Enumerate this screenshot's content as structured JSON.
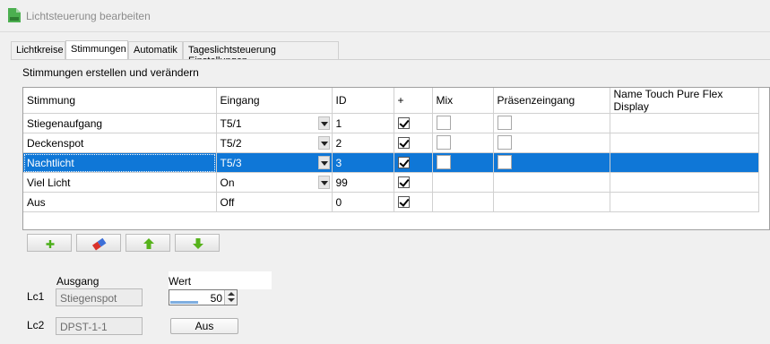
{
  "window": {
    "title": "Lichtsteuerung bearbeiten"
  },
  "tabs": [
    {
      "label": "Lichtkreise",
      "active": false
    },
    {
      "label": "Stimmungen",
      "active": true
    },
    {
      "label": "Automatik",
      "active": false
    },
    {
      "label": "Tageslichtsteuerung Einstellungen",
      "active": false
    }
  ],
  "panel": {
    "heading": "Stimmungen erstellen und verändern"
  },
  "grid": {
    "columns": [
      "Stimmung",
      "Eingang",
      "ID",
      "+",
      "Mix",
      "Präsenzeingang",
      "Name Touch Pure Flex Display"
    ],
    "rows": [
      {
        "stimmung": "Stiegenaufgang",
        "eingang": "T5/1",
        "id": "1",
        "plus": true,
        "dropdown": true,
        "mix": false,
        "praesenz": false,
        "selected": false
      },
      {
        "stimmung": "Deckenspot",
        "eingang": "T5/2",
        "id": "2",
        "plus": true,
        "dropdown": true,
        "mix": false,
        "praesenz": false,
        "selected": false
      },
      {
        "stimmung": "Nachtlicht",
        "eingang": "T5/3",
        "id": "3",
        "plus": true,
        "dropdown": true,
        "mix": false,
        "praesenz": false,
        "selected": true
      },
      {
        "stimmung": "Viel Licht",
        "eingang": "On",
        "id": "99",
        "plus": true,
        "dropdown": true,
        "mix": null,
        "praesenz": null,
        "selected": false
      },
      {
        "stimmung": "Aus",
        "eingang": "Off",
        "id": "0",
        "plus": true,
        "dropdown": false,
        "mix": null,
        "praesenz": null,
        "selected": false
      }
    ]
  },
  "toolbar": {
    "buttons": [
      {
        "name": "add-row-button",
        "icon": "plus-icon",
        "color": "#4caf1a"
      },
      {
        "name": "delete-row-button",
        "icon": "eraser-icon",
        "color": "#d9322b"
      },
      {
        "name": "move-up-button",
        "icon": "arrow-up-icon",
        "color": "#56b21b"
      },
      {
        "name": "move-down-button",
        "icon": "arrow-down-icon",
        "color": "#56b21b"
      }
    ]
  },
  "outputs": {
    "header_ausgang": "Ausgang",
    "header_wert": "Wert",
    "rows": [
      {
        "label": "Lc1",
        "ausgang": "Stiegenspot",
        "wert": "50",
        "level": 0.5
      },
      {
        "label": "Lc2",
        "ausgang": "DPST-1-1",
        "button": "Aus"
      }
    ]
  },
  "colors": {
    "selection": "#0f77d7",
    "accent_green": "#4caf1a"
  }
}
